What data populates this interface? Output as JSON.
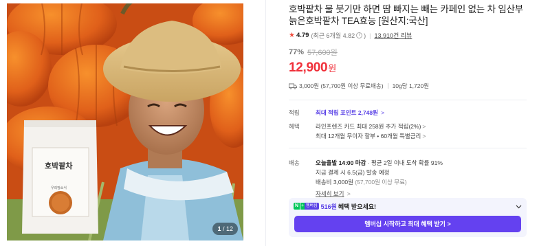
{
  "gallery": {
    "indicator_current": "1",
    "indicator_total": "/ 12",
    "package_title": "호박팥차",
    "package_brand": "우리땅소식"
  },
  "product": {
    "title": "호박팥차 물 붓기만 하면 땀 빠지는 빼는 카페인 없는 차 임산부 늙은호박팥차 TEA효능 [원산지:국산]",
    "rating": "4.79",
    "rating_recent": "(최근 6개월 4.82",
    "rating_recent_close": ")",
    "reviews": "13,910건 리뷰"
  },
  "price": {
    "discount": "77%",
    "original": "57,600원",
    "sale": "12,900",
    "unit": "원"
  },
  "shipping_summary": {
    "fee": "3,000원 (57,700원 이상 무료배송)",
    "per_unit": "10g당 1,720원"
  },
  "points": {
    "label": "적립",
    "link": "최대 적립 포인트 2,748원",
    "chevron": ">"
  },
  "benefits": {
    "label": "혜택",
    "line1": "라인프렌즈 카드 최대 258원 추가 적립(2%)",
    "line2": "최대 12개월 무이자 할부 • 60개월 특별금리",
    "chevron": ">"
  },
  "delivery": {
    "label": "배송",
    "today_bold": "오늘출발 14:00 마감",
    "today_rest": " · 평균 2일 이내 도착 확률 91%",
    "pay_today": "지금 결제 시 6.5(금) 발송 예정",
    "fee": "배송비 3,000원",
    "fee_note": " (57,700원 이상 무료)",
    "more": "자세히 보기",
    "chevron": ">"
  },
  "membership": {
    "badge_n": "N",
    "badge_plus": "+",
    "badge_m": "멤버십",
    "amount": "516원",
    "text": "혜택 받으세요!",
    "cta": "멤버십 시작하고 최대 혜택 받기 >"
  },
  "colors": {
    "price_red": "#f0303a",
    "accent_purple": "#5a42e6",
    "naver_green": "#03c75a"
  }
}
